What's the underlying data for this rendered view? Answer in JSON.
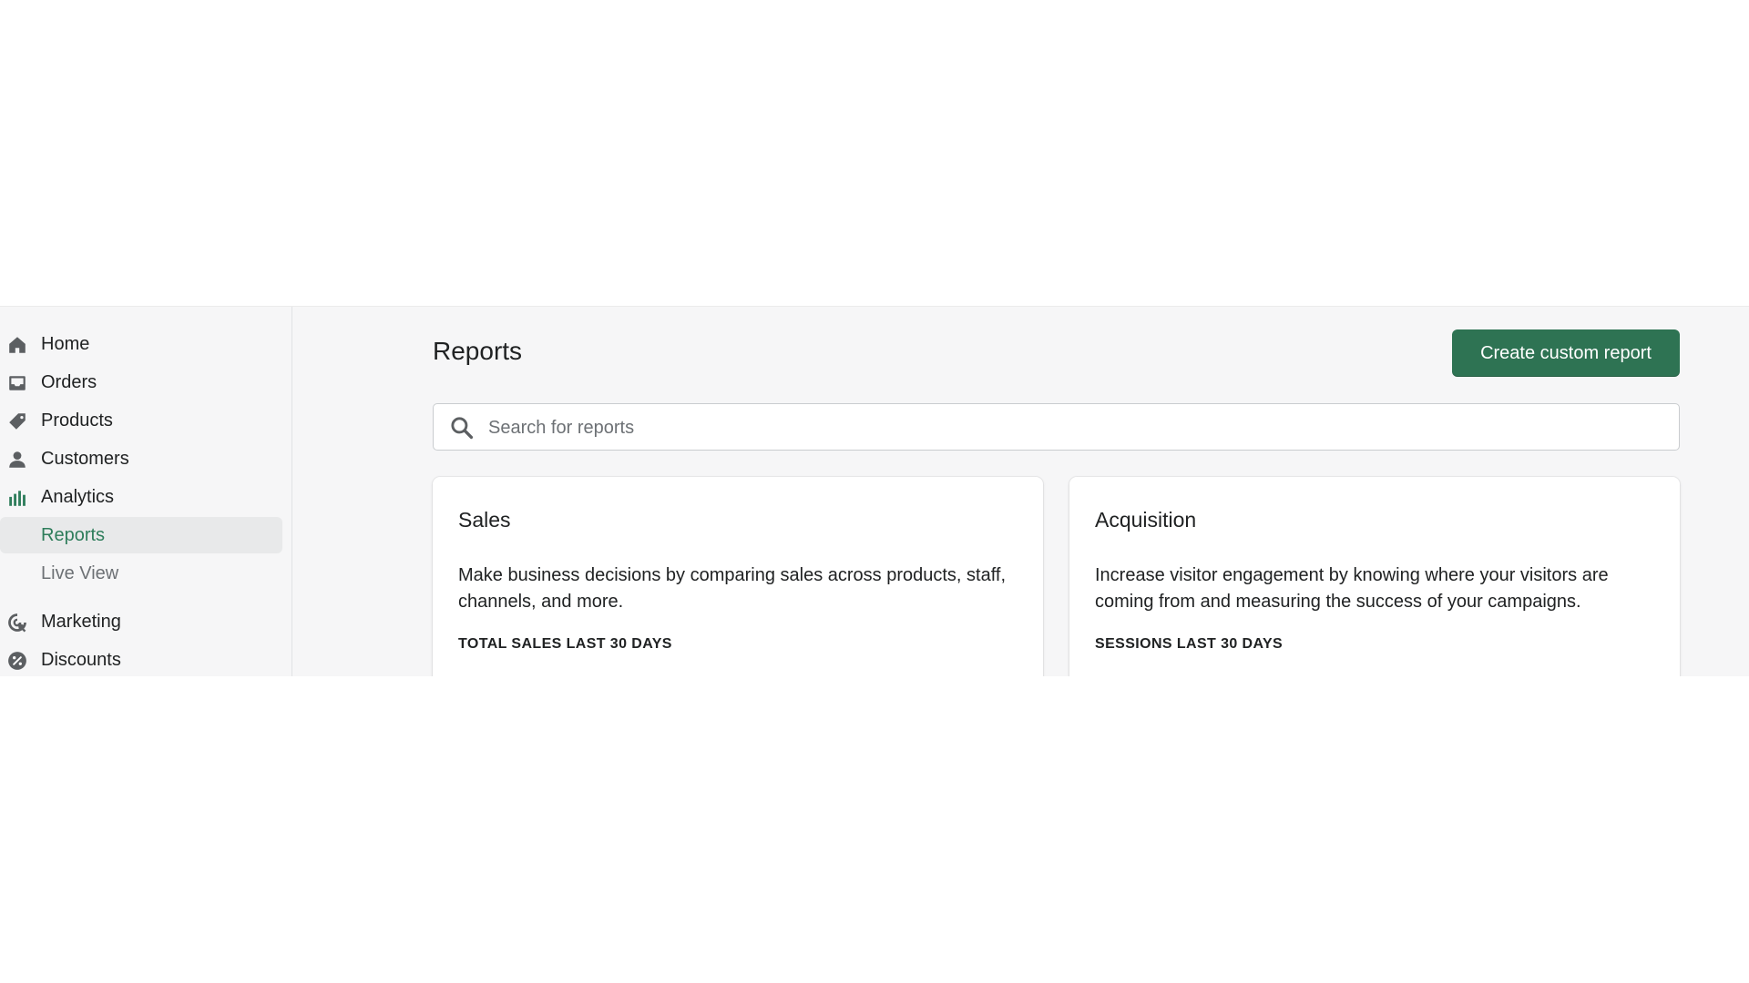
{
  "sidebar": {
    "items": [
      {
        "label": "Home",
        "icon": "home-icon"
      },
      {
        "label": "Orders",
        "icon": "inbox-icon"
      },
      {
        "label": "Products",
        "icon": "tag-icon"
      },
      {
        "label": "Customers",
        "icon": "person-icon"
      },
      {
        "label": "Analytics",
        "icon": "bar-chart-icon"
      },
      {
        "label": "Reports",
        "active": true
      },
      {
        "label": "Live View"
      },
      {
        "label": "Marketing",
        "icon": "target-icon"
      },
      {
        "label": "Discounts",
        "icon": "discount-icon"
      }
    ]
  },
  "header": {
    "title": "Reports",
    "create_button": "Create custom report"
  },
  "search": {
    "placeholder": "Search for reports",
    "value": ""
  },
  "cards": [
    {
      "title": "Sales",
      "description": "Make business decisions by comparing sales across products, staff, channels, and more.",
      "metric": "TOTAL SALES LAST 30 DAYS"
    },
    {
      "title": "Acquisition",
      "description": "Increase visitor engagement by knowing where your visitors are coming from and measuring the success of your campaigns.",
      "metric": "SESSIONS LAST 30 DAYS"
    }
  ],
  "colors": {
    "accent": "#2e7353",
    "active_text": "#2e7d5b",
    "background": "#f6f6f7",
    "icon": "#5c5f62"
  }
}
